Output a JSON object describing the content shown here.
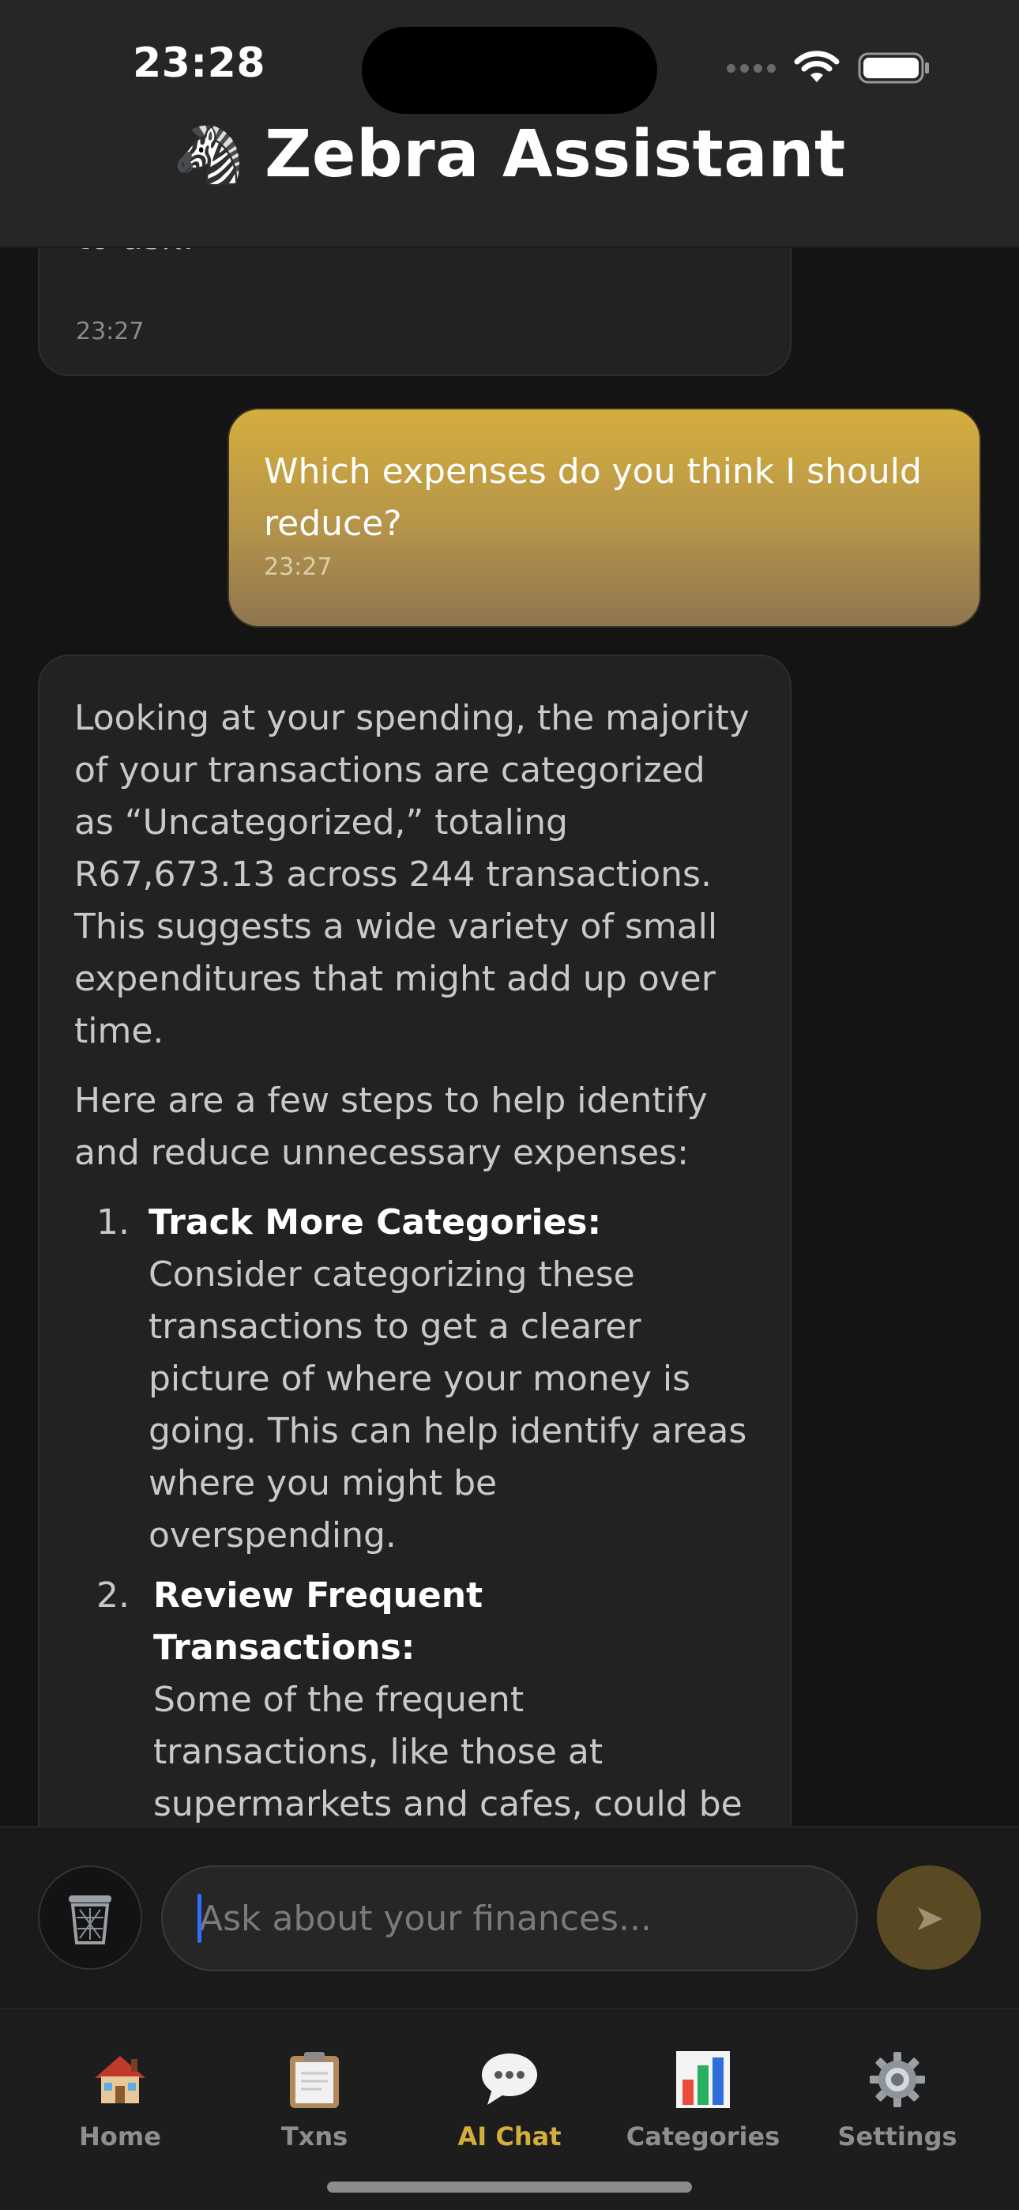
{
  "status_bar": {
    "time": "23:28"
  },
  "header": {
    "logo_emoji": "🦓",
    "title": "Zebra Assistant"
  },
  "messages": [
    {
      "role": "assistant",
      "text": "to ask!",
      "time": "23:27"
    },
    {
      "role": "user",
      "text": "Which expenses do you think I should reduce?",
      "time": "23:27"
    },
    {
      "role": "assistant",
      "paragraphs": [
        "Looking at your spending, the majority of your transactions are categorized as “Uncategorized,” totaling R67,673.13 across 244 transactions. This suggests a wide variety of small expenditures that might add up over time.",
        "Here are a few steps to help identify and reduce unnecessary expenses:"
      ],
      "list": [
        {
          "num": "1.",
          "title": "Track More Categories:",
          "text": "Consider categorizing these transactions to get a clearer picture of where your money is going. This can help identify areas where you might be overspending."
        },
        {
          "num": "2.",
          "title": "Review Frequent Transactions:",
          "text": "Some of the frequent transactions, like those at supermarkets and cafes, could be areas to save. For example, eating out less often or planning meals to minimize grocery trips might help."
        }
      ]
    }
  ],
  "composer": {
    "placeholder": "Ask about your finances...",
    "trash_icon": "trash-icon",
    "send_icon": "send-icon",
    "send_glyph": "➤"
  },
  "tabs": [
    {
      "label": "Home",
      "icon": "house-icon",
      "active": false
    },
    {
      "label": "Txns",
      "icon": "clipboard-icon",
      "active": false
    },
    {
      "label": "AI Chat",
      "icon": "speech-bubble-icon",
      "active": true
    },
    {
      "label": "Categories",
      "icon": "bar-chart-icon",
      "active": false
    },
    {
      "label": "Settings",
      "icon": "gear-icon",
      "active": false
    }
  ],
  "colors": {
    "accent": "#d4ae3d",
    "background": "#141414",
    "header": "#262626"
  }
}
